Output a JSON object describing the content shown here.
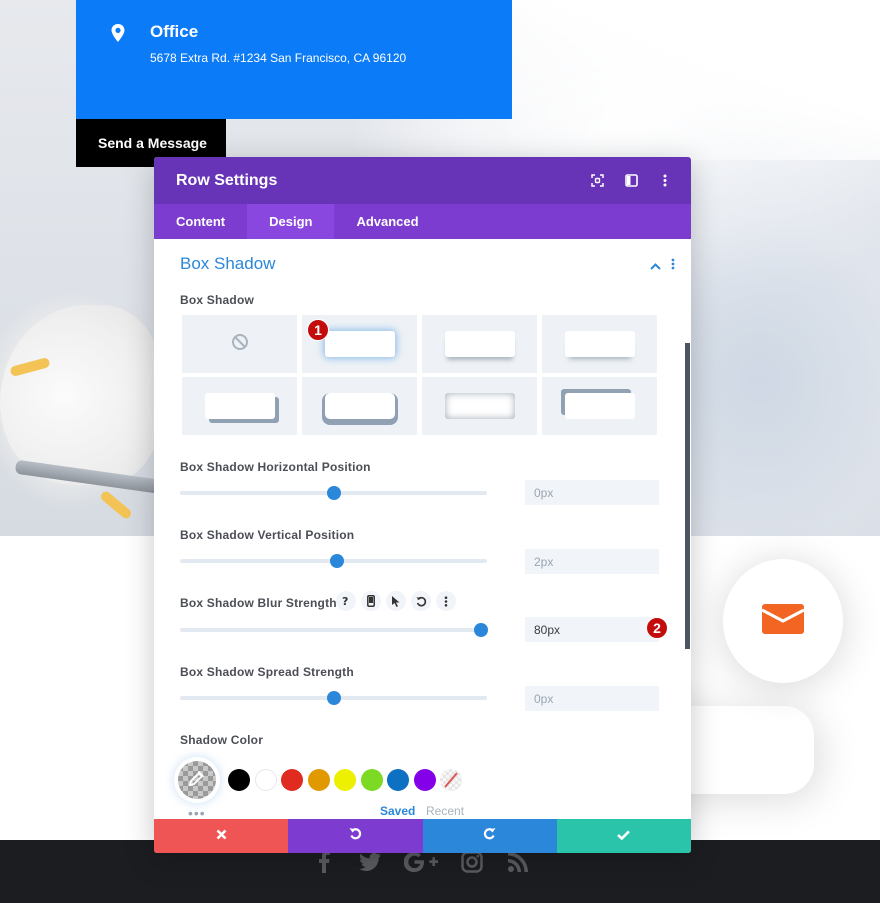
{
  "background": {
    "office": {
      "title": "Office",
      "address": "5678 Extra Rd. #1234 San Francisco, CA 96120",
      "icon": "map-pin-icon",
      "color": "#0c7bf7"
    },
    "send_message_label": "Send a Message",
    "contact_icon": "envelope-icon",
    "contact_icon_color": "#f26522",
    "social_icons": [
      "facebook-icon",
      "twitter-icon",
      "google-plus-icon",
      "instagram-icon",
      "rss-icon"
    ]
  },
  "modal": {
    "title": "Row Settings",
    "header_icons": [
      "fullscreen-icon",
      "split-view-icon",
      "more-vertical-icon"
    ],
    "tabs": [
      {
        "label": "Content",
        "active": false
      },
      {
        "label": "Design",
        "active": true
      },
      {
        "label": "Advanced",
        "active": false
      }
    ],
    "section": {
      "title": "Box Shadow",
      "collapse_icon": "chevron-up-icon",
      "more_icon": "more-vertical-icon"
    },
    "box_shadow_label": "Box Shadow",
    "presets": [
      {
        "name": "none",
        "selected": false
      },
      {
        "name": "preset-1",
        "selected": true
      },
      {
        "name": "preset-2",
        "selected": false
      },
      {
        "name": "preset-3",
        "selected": false
      },
      {
        "name": "preset-4",
        "selected": false
      },
      {
        "name": "preset-5",
        "selected": false
      },
      {
        "name": "preset-6",
        "selected": false
      },
      {
        "name": "preset-7",
        "selected": false
      }
    ],
    "fields": {
      "horizontal": {
        "label": "Box Shadow Horizontal Position",
        "value": "0px",
        "slider_fraction": 0.5
      },
      "vertical": {
        "label": "Box Shadow Vertical Position",
        "value": "2px",
        "slider_fraction": 0.51
      },
      "blur": {
        "label": "Box Shadow Blur Strength",
        "value": "80px",
        "slider_fraction": 0.98,
        "tools": [
          "help-icon",
          "mobile-icon",
          "cursor-icon",
          "reset-icon",
          "more-vertical-icon"
        ]
      },
      "spread": {
        "label": "Box Shadow Spread Strength",
        "value": "0px",
        "slider_fraction": 0.5
      }
    },
    "shadow_color": {
      "label": "Shadow Color",
      "swatches": [
        "#000000",
        "#ffffff",
        "#e02b20",
        "#e09900",
        "#edf000",
        "#7cda24",
        "#0c71c3",
        "#8300e9"
      ],
      "tabs": {
        "saved": "Saved",
        "recent": "Recent"
      },
      "more": "•••"
    },
    "annotations": {
      "badge_1": "1",
      "badge_2": "2"
    },
    "actions": {
      "cancel": "close-icon",
      "undo": "undo-icon",
      "redo": "redo-icon",
      "save": "check-icon"
    }
  }
}
